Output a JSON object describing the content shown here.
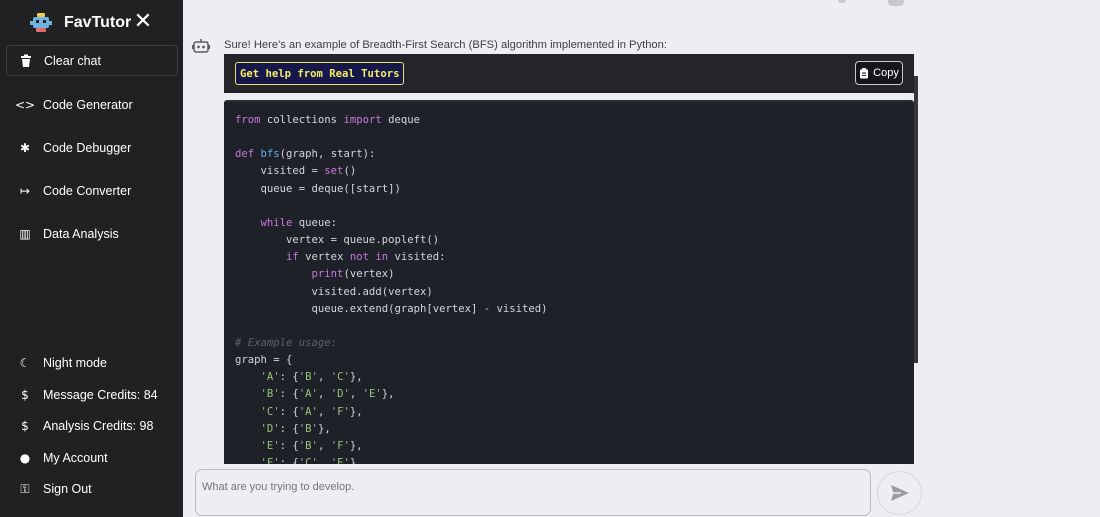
{
  "brand": {
    "name": "FavTutor",
    "close_symbol": "✕"
  },
  "sidebar": {
    "clear_chat": "Clear chat",
    "items": [
      {
        "label": "Code Generator",
        "icon": "code-icon",
        "symbol": "<>"
      },
      {
        "label": "Code Debugger",
        "icon": "bug-icon",
        "symbol": "✱"
      },
      {
        "label": "Code Converter",
        "icon": "arrow-right-icon",
        "symbol": "↦"
      },
      {
        "label": "Data Analysis",
        "icon": "chart-icon",
        "symbol": "▥"
      }
    ],
    "bottom": [
      {
        "label": "Night mode",
        "icon": "moon-icon",
        "symbol": "☾"
      },
      {
        "label": "Message Credits: 84",
        "icon": "dollar-icon",
        "symbol": "$"
      },
      {
        "label": "Analysis Credits: 98",
        "icon": "dollar-icon",
        "symbol": "$"
      },
      {
        "label": "My Account",
        "icon": "user-icon",
        "symbol": "●"
      },
      {
        "label": "Sign Out",
        "icon": "key-icon",
        "symbol": "⚿"
      }
    ]
  },
  "chat": {
    "intro": "Sure! Here's an example of Breadth-First Search (BFS) algorithm implemented in Python:",
    "help_button": "Get help from Real Tutors",
    "copy_button": "Copy",
    "code_lines": [
      [
        [
          "from",
          "kw"
        ],
        [
          " collections ",
          ""
        ],
        [
          "import",
          "kw"
        ],
        [
          " deque",
          ""
        ]
      ],
      [],
      [
        [
          "def",
          "kw"
        ],
        [
          " ",
          ""
        ],
        [
          "bfs",
          "fn"
        ],
        [
          "(graph, start):",
          ""
        ]
      ],
      [
        [
          "    visited = ",
          ""
        ],
        [
          "set",
          "kw"
        ],
        [
          "()",
          ""
        ]
      ],
      [
        [
          "    queue = deque([start])",
          ""
        ]
      ],
      [],
      [
        [
          "    ",
          ""
        ],
        [
          "while",
          "kw"
        ],
        [
          " queue:",
          ""
        ]
      ],
      [
        [
          "        vertex = queue.popleft()",
          ""
        ]
      ],
      [
        [
          "        ",
          ""
        ],
        [
          "if",
          "kw"
        ],
        [
          " vertex ",
          ""
        ],
        [
          "not in",
          "kw"
        ],
        [
          " visited:",
          ""
        ]
      ],
      [
        [
          "            ",
          ""
        ],
        [
          "print",
          "kw"
        ],
        [
          "(vertex)",
          ""
        ]
      ],
      [
        [
          "            visited.add(vertex)",
          ""
        ]
      ],
      [
        [
          "            queue.extend(graph[vertex] - visited)",
          ""
        ]
      ],
      [],
      [
        [
          "# Example usage:",
          "cm"
        ]
      ],
      [
        [
          "graph = {",
          ""
        ]
      ],
      [
        [
          "    ",
          ""
        ],
        [
          "'A'",
          "str"
        ],
        [
          ": {",
          ""
        ],
        [
          "'B'",
          "str"
        ],
        [
          ", ",
          ""
        ],
        [
          "'C'",
          "str"
        ],
        [
          "},",
          ""
        ]
      ],
      [
        [
          "    ",
          ""
        ],
        [
          "'B'",
          "str"
        ],
        [
          ": {",
          ""
        ],
        [
          "'A'",
          "str"
        ],
        [
          ", ",
          ""
        ],
        [
          "'D'",
          "str"
        ],
        [
          ", ",
          ""
        ],
        [
          "'E'",
          "str"
        ],
        [
          "},",
          ""
        ]
      ],
      [
        [
          "    ",
          ""
        ],
        [
          "'C'",
          "str"
        ],
        [
          ": {",
          ""
        ],
        [
          "'A'",
          "str"
        ],
        [
          ", ",
          ""
        ],
        [
          "'F'",
          "str"
        ],
        [
          "},",
          ""
        ]
      ],
      [
        [
          "    ",
          ""
        ],
        [
          "'D'",
          "str"
        ],
        [
          ": {",
          ""
        ],
        [
          "'B'",
          "str"
        ],
        [
          "},",
          ""
        ]
      ],
      [
        [
          "    ",
          ""
        ],
        [
          "'E'",
          "str"
        ],
        [
          ": {",
          ""
        ],
        [
          "'B'",
          "str"
        ],
        [
          ", ",
          ""
        ],
        [
          "'F'",
          "str"
        ],
        [
          "},",
          ""
        ]
      ],
      [
        [
          "    ",
          ""
        ],
        [
          "'F'",
          "str"
        ],
        [
          ": {",
          ""
        ],
        [
          "'C'",
          "str"
        ],
        [
          ", ",
          ""
        ],
        [
          "'E'",
          "str"
        ],
        [
          "}",
          ""
        ]
      ]
    ]
  },
  "input": {
    "placeholder": "What are you trying to develop."
  },
  "colors": {
    "sidebar_bg": "#202123",
    "code_bg": "#1f2128",
    "keyword": "#c678dd",
    "function": "#61afef",
    "string": "#98c379",
    "help_button_border": "#e8e26a"
  }
}
